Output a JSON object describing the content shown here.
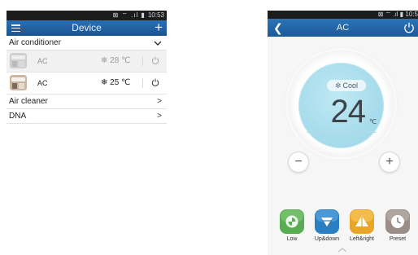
{
  "left_screen": {
    "status_time": "10:53",
    "nav_title": "Device",
    "sections": [
      {
        "label": "Air conditioner",
        "chevron": "⌄",
        "expanded": true
      },
      {
        "label": "Air cleaner",
        "chevron": ">"
      },
      {
        "label": "DNA",
        "chevron": ">"
      }
    ],
    "devices": [
      {
        "name": "AC",
        "temp": "28 ℃",
        "mode_icon": "❄",
        "state": "offline"
      },
      {
        "name": "AC",
        "temp": "25 ℃",
        "mode_icon": "❄",
        "state": "online"
      }
    ]
  },
  "right_screen": {
    "status_time": "10:5",
    "nav_title": "AC",
    "mode_label": "Cool",
    "temperature": "24",
    "unit": "℃",
    "minus": "−",
    "plus": "+",
    "functions": [
      {
        "label": "Low",
        "color": "#58ad52"
      },
      {
        "label": "Up&down",
        "color": "#2a7fc2"
      },
      {
        "label": "Left&right",
        "color": "#e8a628"
      },
      {
        "label": "Preset",
        "color": "#9a8e86"
      }
    ]
  },
  "colors": {
    "nav_blue": "#1f5fa0",
    "dial_cyan": "#a7dcec"
  }
}
